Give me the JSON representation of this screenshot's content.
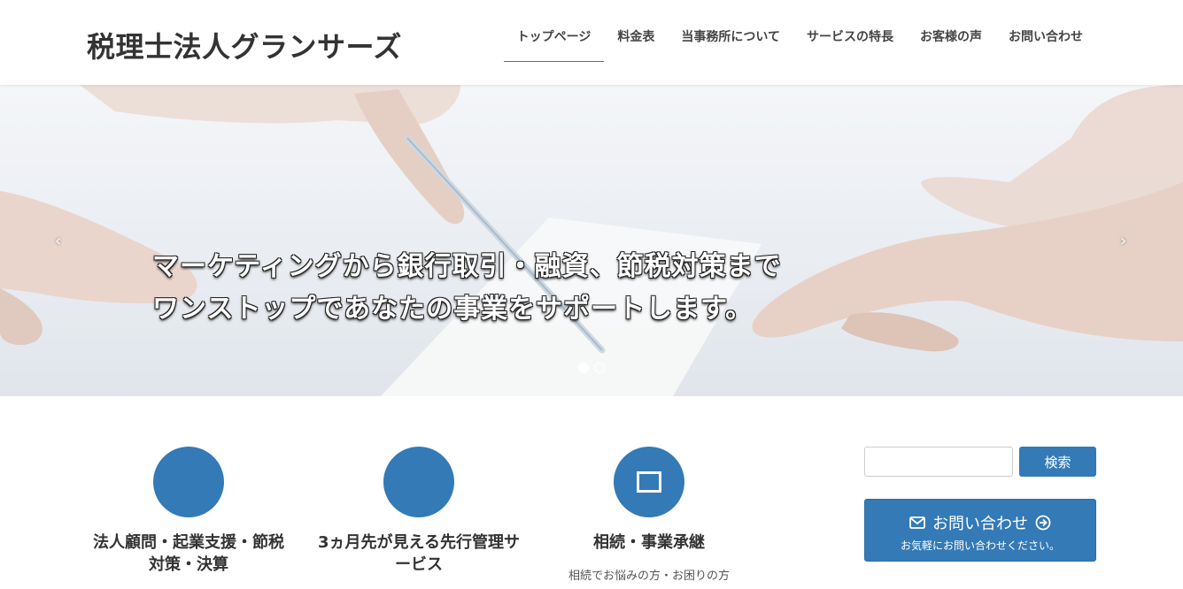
{
  "site": {
    "title": "税理士法人グランサーズ"
  },
  "nav": {
    "items": [
      {
        "label": "トップページ",
        "active": true
      },
      {
        "label": "料金表"
      },
      {
        "label": "当事務所について"
      },
      {
        "label": "サービスの特長"
      },
      {
        "label": "お客様の声"
      },
      {
        "label": "お問い合わせ"
      }
    ]
  },
  "hero": {
    "caption_line1": "マーケティングから銀行取引・融資、節税対策まで",
    "caption_line2": "ワンストップであなたの事業をサポートします。",
    "prev_arrow": "‹",
    "next_arrow": "›",
    "active_slide": 1,
    "slide_count": 2
  },
  "services": [
    {
      "title_line1": "法人顧問・起業支援・節税",
      "title_line2": "対策・決算",
      "icon": "blank-circle-icon"
    },
    {
      "title_line1": "3ヵ月先が見える先行管理サ",
      "title_line2": "ービス",
      "icon": "blank-circle-icon"
    },
    {
      "title_line1": "相続・事業承継",
      "title_line2": "",
      "text": "相続でお悩みの方・お困りの方",
      "icon": "square-icon"
    }
  ],
  "sidebar": {
    "search_button": "検索",
    "contact_label": "お問い合わせ",
    "contact_sub": "お気軽にお問い合わせください。",
    "envelope_icon": "envelope-icon",
    "arrow_icon": "arrow-circle-right-icon"
  },
  "colors": {
    "accent": "#337ab7",
    "text": "#333333"
  }
}
